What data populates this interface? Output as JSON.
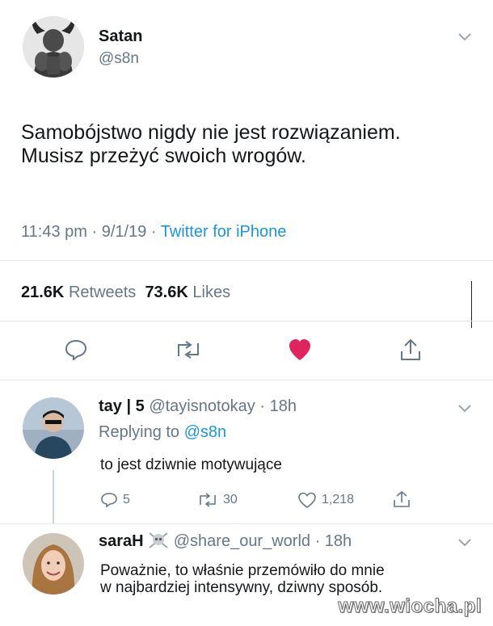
{
  "main_tweet": {
    "display_name": "Satan",
    "handle": "@s8n",
    "text_line1": "Samobójstwo nigdy nie jest rozwiązaniem.",
    "text_line2": "Musisz przeżyć swoich wrogów.",
    "time": "11:43 pm",
    "date": "9/1/19",
    "source": "Twitter for iPhone",
    "retweets_count": "21.6K",
    "retweets_label": "Retweets",
    "likes_count": "73.6K",
    "likes_label": "Likes"
  },
  "reply1": {
    "display_name": "tay | 5",
    "handle": "@tayisnotokay",
    "time": "18h",
    "replying_to_label": "Replying to",
    "replying_to_handle": "@s8n",
    "text": "to jest dziwnie motywujące",
    "reply_count": "5",
    "retweet_count": "30",
    "like_count": "1,218"
  },
  "reply2": {
    "display_name": "saraH",
    "handle": "@share_our_world",
    "time": "18h",
    "text_line1": "Poważnie, to właśnie przemówiło do mnie",
    "text_line2": "w najbardziej intensywny, dziwny sposób."
  },
  "watermark": "www.wiocha.pl",
  "colors": {
    "like_red": "#e0245e",
    "link_blue": "#1b95e0",
    "muted": "#657786"
  },
  "icons": [
    "demon-avatar",
    "chevron-down-icon",
    "reply-icon",
    "retweet-icon",
    "heart-icon",
    "share-icon",
    "skull-icon"
  ]
}
